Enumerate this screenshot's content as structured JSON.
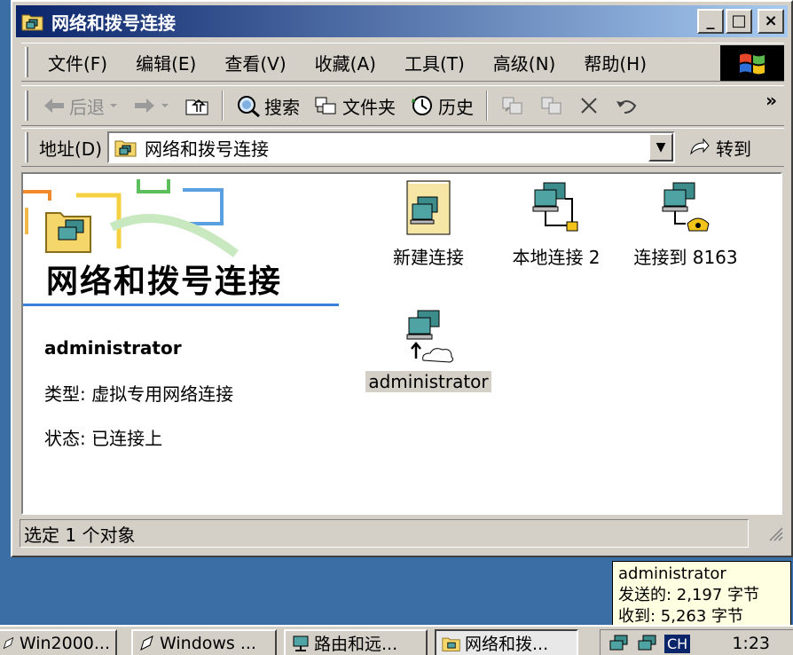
{
  "window": {
    "title": "网络和拨号连接"
  },
  "window_buttons": {
    "minimize": "_",
    "maximize": "□",
    "close": "×"
  },
  "menu": [
    {
      "label": "文件(F)"
    },
    {
      "label": "编辑(E)"
    },
    {
      "label": "查看(V)"
    },
    {
      "label": "收藏(A)"
    },
    {
      "label": "工具(T)"
    },
    {
      "label": "高级(N)"
    },
    {
      "label": "帮助(H)"
    }
  ],
  "toolbar": {
    "back_label": "后退",
    "search_label": "搜索",
    "folders_label": "文件夹",
    "history_label": "历史",
    "more": "»"
  },
  "address": {
    "label": "地址(D)",
    "value": "网络和拨号连接",
    "go_label": "转到"
  },
  "panel": {
    "title": "网络和拨号连接",
    "selected_name": "administrator",
    "type_line": "类型: 虚拟专用网络连接",
    "status_line": "状态: 已连接上"
  },
  "icons": [
    {
      "label": "新建连接"
    },
    {
      "label": "本地连接 2"
    },
    {
      "label": "连接到 8163"
    },
    {
      "label": "administrator"
    }
  ],
  "statusbar": {
    "text": "选定 1 个对象"
  },
  "tooltip": {
    "name": "administrator",
    "sent": "发送的: 2,197 字节",
    "received": "收到: 5,263 字节"
  },
  "taskbar": {
    "buttons": [
      {
        "label": "Win2000..."
      },
      {
        "label": "Windows ..."
      },
      {
        "label": "路由和远..."
      },
      {
        "label": "网络和拨..."
      }
    ],
    "ime": "CH",
    "clock": "1:23"
  },
  "colors": {
    "titlebar_start": "#0a246a",
    "titlebar_end": "#a6caf0",
    "desktop": "#3a6ea5",
    "face": "#d4d0c8",
    "tooltip_bg": "#ffffe1"
  }
}
